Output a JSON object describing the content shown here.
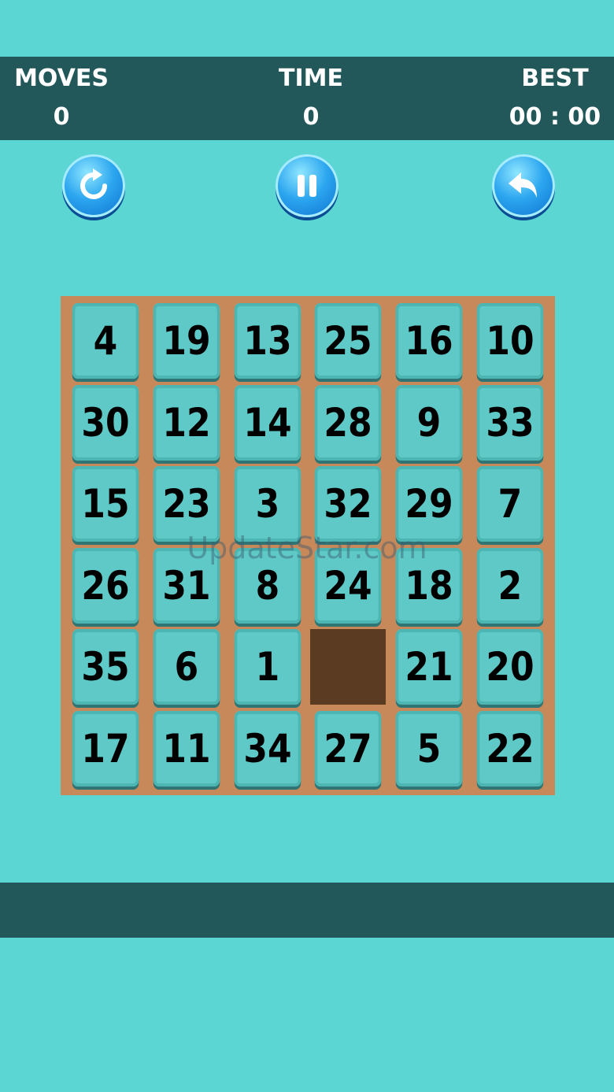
{
  "header": {
    "moves_label": "MOVES",
    "moves_value": "0",
    "time_label": "TIME",
    "time_value": "0",
    "best_label": "BEST",
    "best_value": "00 : 00"
  },
  "controls": {
    "restart_icon": "refresh-icon",
    "pause_icon": "pause-icon",
    "back_icon": "undo-arrow-icon"
  },
  "board": {
    "rows": 6,
    "cols": 6,
    "tiles": [
      [
        4,
        19,
        13,
        25,
        16,
        10
      ],
      [
        30,
        12,
        14,
        28,
        9,
        33
      ],
      [
        15,
        23,
        3,
        32,
        29,
        7
      ],
      [
        26,
        31,
        8,
        24,
        18,
        2
      ],
      [
        35,
        6,
        1,
        null,
        21,
        20
      ],
      [
        17,
        11,
        34,
        27,
        5,
        22
      ]
    ]
  },
  "watermark": "UpdateStar.com",
  "colors": {
    "background": "#5cd6d3",
    "header_bar": "#23585a",
    "board_frame": "#c8895a",
    "tile": "#5ec9c6",
    "empty_cell": "#5b3b22"
  }
}
